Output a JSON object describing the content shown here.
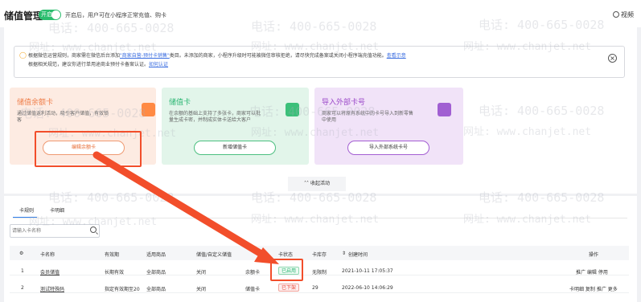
{
  "header": {
    "title": "储值管理",
    "toggle_label": "开启",
    "toggle_note": "开启后，用户可在小程序正常充值、购卡",
    "video_label": "视频"
  },
  "notice": {
    "text_before": "根据微信运营规则，商家需在微信后台添加",
    "link1": "\"商家自营-预付卡销售\"",
    "text_mid": "类目。未添加的商家，小程序升级时可能被微信审核拒绝，请尽快完成备案或关闭小程序端充值功能。",
    "link2": "查看示意",
    "line2_before": "根据相关规范，建议你进行单用途商业预付卡备案认证。",
    "link3": "如何认证"
  },
  "cards": [
    {
      "title": "储值余额卡",
      "desc": "通过储值返利活动，吸引客户储值，有效锁客",
      "button": "编辑余额卡"
    },
    {
      "title": "储值卡",
      "desc": "在余额的基础上支持了多张卡，商家可以批量生成卡密，并制成实体卡送给大客户",
      "button": "新增储值卡"
    },
    {
      "title": "导入外部卡号",
      "desc": "商家可以将原有系统中的卡号导入到新零售中使用",
      "button": "导入外部系统卡号"
    }
  ],
  "collapse_label": "收起活动",
  "tabs": [
    "卡规则",
    "卡明细"
  ],
  "search": {
    "placeholder": "请输入卡名称"
  },
  "table": {
    "columns": [
      "",
      "卡名称",
      "有效期",
      "适用商品",
      "储值/自定义储值",
      "",
      "卡状态",
      "卡库存",
      "创建时间",
      "操作"
    ],
    "rows": [
      {
        "index": "1",
        "name": "会员储值",
        "validity": "长期有效",
        "goods": "全部商品",
        "custom": "关闭",
        "type": "余额卡",
        "status": "已启用",
        "stock": "无限制",
        "created": "2021-10-11 17:05:37",
        "actions": "推广  编辑  停用"
      },
      {
        "index": "2",
        "name": "测试特殊码",
        "validity": "指定有效期至20",
        "goods": "全部商品",
        "custom": "关闭",
        "type": "储值卡",
        "status": "已下架",
        "stock": "29",
        "created": "2022-06-10 14:06:29",
        "actions": "卡明细  复制  推广  更多"
      }
    ]
  },
  "watermark": {
    "phone": "电话: 400-665-0028",
    "site": "网址: www.chanjet.net"
  },
  "colors": {
    "accent": "#2f80ed",
    "toggle": "#2bbd6e",
    "annotation_red": "#f24e2b"
  }
}
